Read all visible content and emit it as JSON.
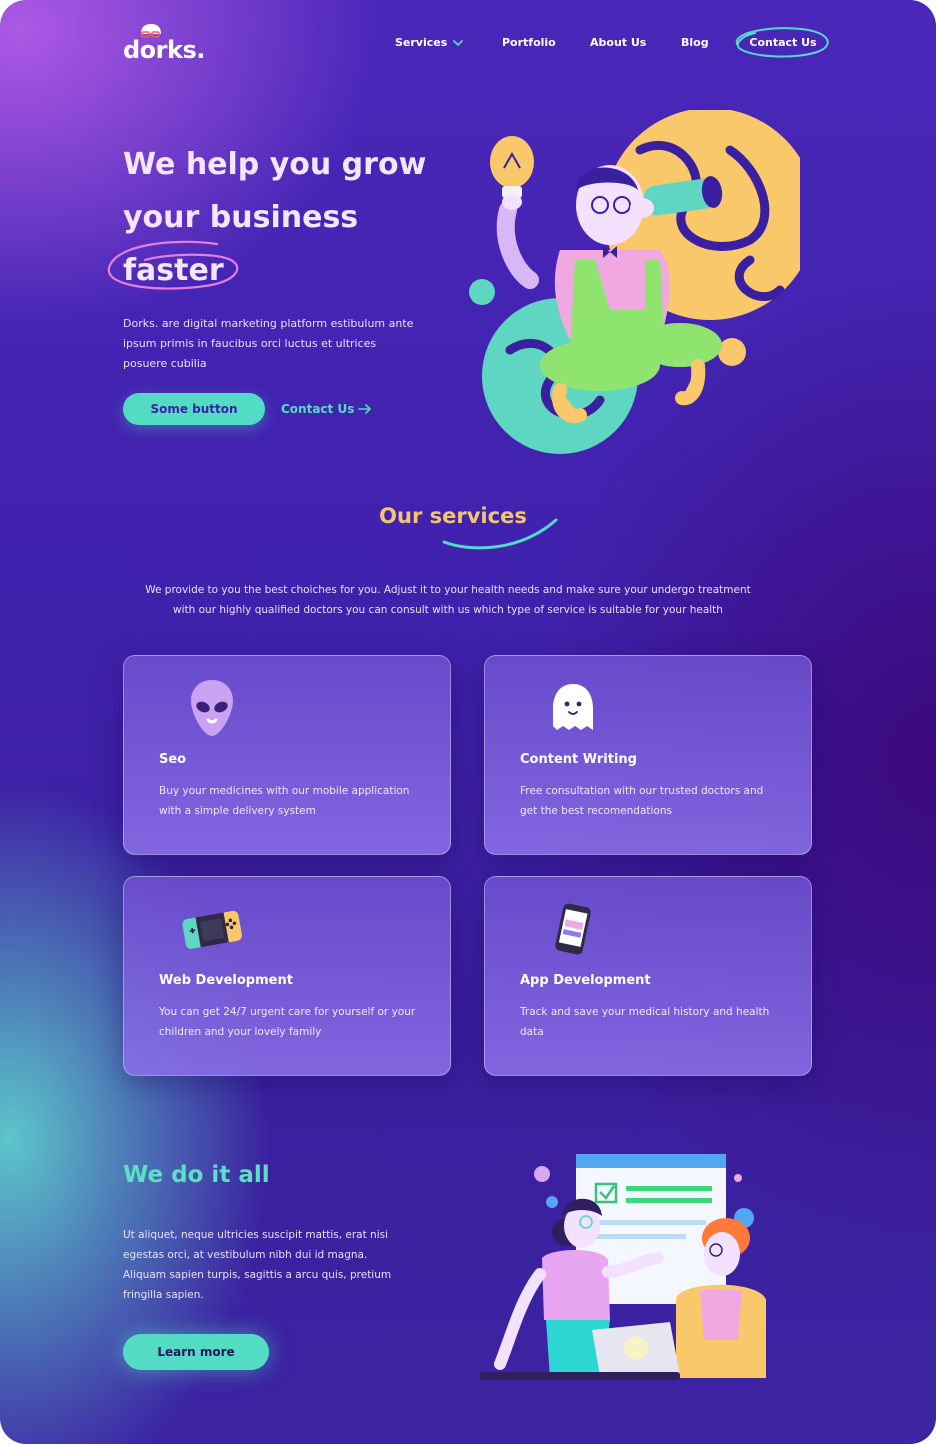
{
  "brand": {
    "logo_text": "dorks."
  },
  "nav": {
    "services": "Services",
    "portfolio": "Portfolio",
    "about": "About Us",
    "blog": "Blog",
    "contact": "Contact Us"
  },
  "hero": {
    "title_line1": "We help you grow",
    "title_line2": "your business",
    "title_line3": "faster",
    "description": "Dorks. are digital marketing platform estibulum ante ipsum primis in faucibus orci luctus et ultrices posuere cubilia",
    "primary_button": "Some button",
    "contact_link": "Contact Us"
  },
  "services": {
    "title": "Our services",
    "description": "We provide to you the best choiches for you. Adjust it to your health needs and make sure your undergo treatment with our highly qualified doctors you can consult with us which type of service is suitable for your health",
    "cards": [
      {
        "title": "Seo",
        "text": "Buy  your medicines with our mobile application with a simple delivery system",
        "icon": "alien-icon"
      },
      {
        "title": "Content Writing",
        "text": "Free consultation with our trusted doctors and get the best recomendations",
        "icon": "ghost-icon"
      },
      {
        "title": "Web Development",
        "text": "You can get 24/7 urgent care for yourself or your children and your lovely family",
        "icon": "game-console-icon"
      },
      {
        "title": "App Development",
        "text": "Track and save your medical history and health data",
        "icon": "phone-icon"
      }
    ]
  },
  "doall": {
    "title": "We do it all",
    "description": "Ut aliquet, neque ultricies suscipit mattis, erat nisi egestas orci, at vestibulum nibh dui id magna. Aliquam sapien turpis, sagittis a arcu quis, pretium fringilla sapien.",
    "button": "Learn more"
  },
  "colors": {
    "background": "#4126b0",
    "accent_teal": "#52dcc4",
    "accent_yellow": "#f2c66d",
    "card_bg": "#7b5fdc"
  }
}
